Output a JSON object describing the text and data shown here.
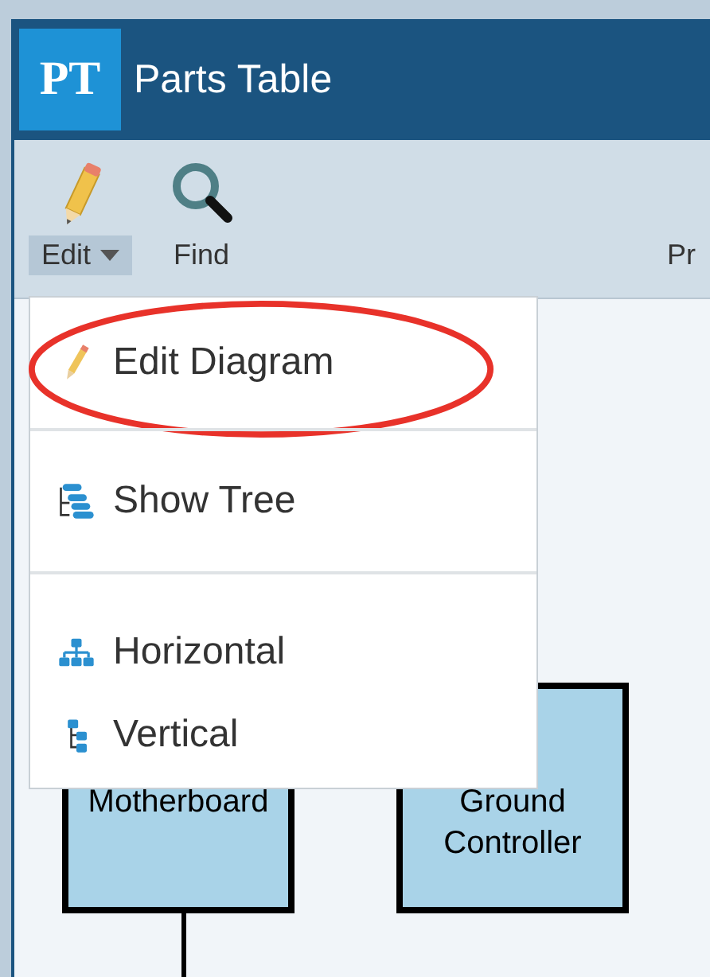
{
  "window": {
    "logo": "PT",
    "title": "Parts Table"
  },
  "toolbar": [
    {
      "label": "Edit",
      "kind": "dropdown",
      "expanded": true
    },
    {
      "label": "Find",
      "kind": "find"
    },
    {
      "label": "Pr",
      "kind": "plain"
    }
  ],
  "menu": {
    "groups": [
      [
        {
          "label": "Edit Diagram",
          "kind": "pencil",
          "highlighted": true
        }
      ],
      [
        {
          "label": "Show Tree",
          "kind": "tree",
          "highlighted": false
        }
      ],
      [
        {
          "label": "Horizontal",
          "kind": "horizontal",
          "highlighted": false
        },
        {
          "label": "Vertical",
          "kind": "vertical",
          "highlighted": false
        }
      ]
    ]
  },
  "diagram": {
    "nodes": [
      {
        "label": "Motherboard",
        "connector": true
      },
      {
        "label": "Ground Controller",
        "connector": false
      }
    ]
  }
}
